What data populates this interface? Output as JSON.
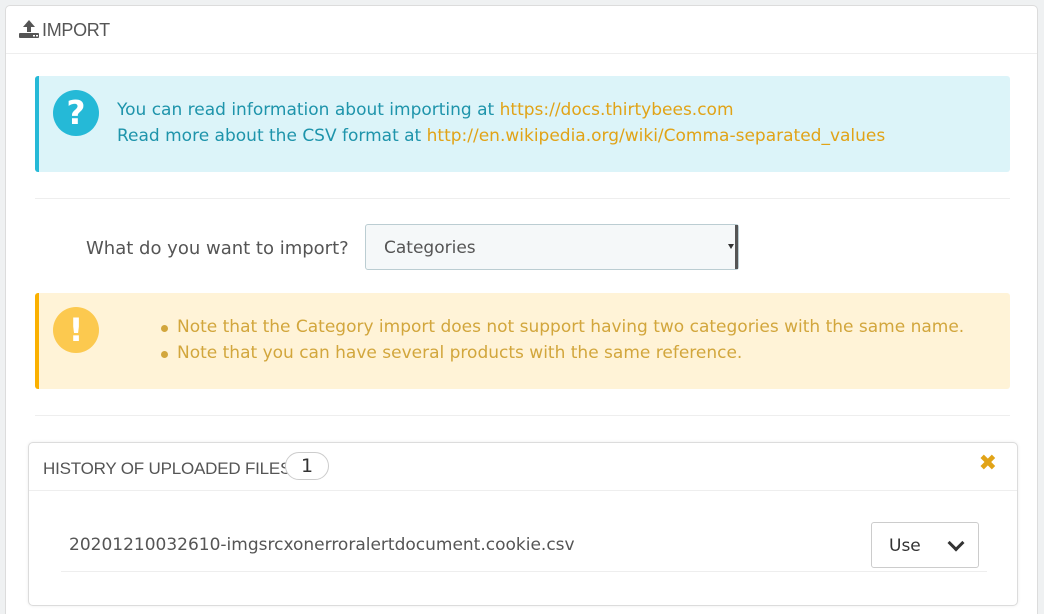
{
  "panel": {
    "title": "IMPORT",
    "icon": "upload-icon"
  },
  "info_alert": {
    "icon": "question-icon",
    "line1_prefix": "You can read information about importing at ",
    "line1_link": "https://docs.thirtybees.com",
    "line2_prefix": "Read more about the CSV format at ",
    "line2_link": "http://en.wikipedia.org/wiki/Comma-separated_values",
    "color": "#25b9d7"
  },
  "form": {
    "label": "What do you want to import?",
    "selected": "Categories"
  },
  "warning_alert": {
    "icon": "exclamation-icon",
    "items": [
      "Note that the Category import does not support having two categories with the same name.",
      "Note that you can have several products with the same reference."
    ],
    "color": "#fab000"
  },
  "history": {
    "title": "HISTORY OF UPLOADED FILES",
    "count": "1",
    "close_icon": "close-icon",
    "files": [
      {
        "name": "20201210032610-imgsrcxonerroralertdocument.cookie.csv",
        "action": "Use"
      }
    ]
  },
  "colors": {
    "link": "#e1a317",
    "info_text": "#1e94ab",
    "warning_text": "#d2a63c"
  }
}
